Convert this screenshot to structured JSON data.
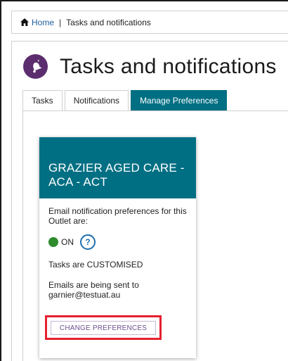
{
  "breadcrumb": {
    "home_label": "Home",
    "separator": "|",
    "current": "Tasks and notifications"
  },
  "page": {
    "title": "Tasks and notifications",
    "icon": "bell-icon",
    "accent_color": "#5b2d6e"
  },
  "tabs": [
    {
      "label": "Tasks",
      "active": false
    },
    {
      "label": "Notifications",
      "active": false
    },
    {
      "label": "Manage Preferences",
      "active": true
    }
  ],
  "card": {
    "header_color": "#006f83",
    "title": "GRAZIER AGED CARE - ACA - ACT",
    "prefs_text": "Email notification preferences for this Outlet are:",
    "status_label": "ON",
    "status_color": "#2e8b2e",
    "help_symbol": "?",
    "tasks_text": "Tasks are CUSTOMISED",
    "emails_text": "Emails are being sent to garnier@testuat.au",
    "button_label": "CHANGE PREFERENCES",
    "highlight_color": "#e5202e"
  }
}
